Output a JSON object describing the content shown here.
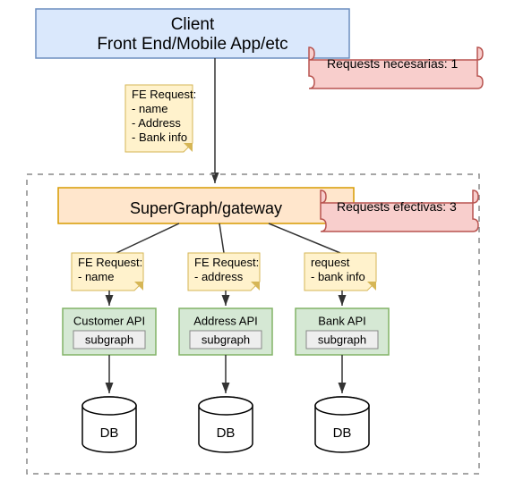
{
  "client": {
    "line1": "Client",
    "line2": "Front End/Mobile App/etc"
  },
  "scrolls": {
    "necessary": "Requests necesarias: 1",
    "effective": "Requests efectivas: 3"
  },
  "fe_request_main": {
    "title": "FE Request:",
    "items": [
      "- name",
      "- Address",
      "- Bank info"
    ]
  },
  "gateway": {
    "label": "SuperGraph/gateway"
  },
  "sub_requests": [
    {
      "title": "FE Request:",
      "item": "- name"
    },
    {
      "title": "FE Request:",
      "item": "- address"
    },
    {
      "title": "request",
      "item": "- bank info"
    }
  ],
  "apis": [
    {
      "label": "Customer API",
      "sub": "subgraph",
      "db": "DB"
    },
    {
      "label": "Address API",
      "sub": "subgraph",
      "db": "DB"
    },
    {
      "label": "Bank API",
      "sub": "subgraph",
      "db": "DB"
    }
  ]
}
